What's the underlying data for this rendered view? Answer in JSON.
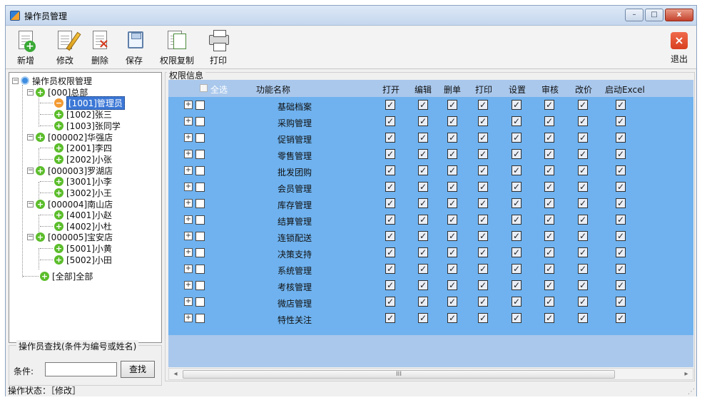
{
  "window": {
    "title": "操作员管理",
    "minimize": "–",
    "maximize": "□",
    "close": "x"
  },
  "toolbar": {
    "new_label": "新增",
    "edit_label": "修改",
    "delete_label": "删除",
    "save_label": "保存",
    "copy_permission_label": "权限复制",
    "print_label": "打印",
    "exit_label": "退出"
  },
  "tree": {
    "root": "操作员权限管理",
    "items": [
      {
        "label": "[000]总部",
        "level": 1,
        "icon": "green-plus-icon",
        "selected": false
      },
      {
        "label": "[1001]管理员",
        "level": 2,
        "icon": "orange-minus-icon",
        "selected": true
      },
      {
        "label": "[1002]张三",
        "level": 2,
        "icon": "green-plus-icon",
        "selected": false
      },
      {
        "label": "[1003]张同学",
        "level": 2,
        "icon": "green-plus-icon",
        "selected": false
      },
      {
        "label": "[000002]华强店",
        "level": 1,
        "icon": "green-plus-icon",
        "selected": false
      },
      {
        "label": "[2001]李四",
        "level": 2,
        "icon": "green-plus-icon",
        "selected": false
      },
      {
        "label": "[2002]小张",
        "level": 2,
        "icon": "green-plus-icon",
        "selected": false
      },
      {
        "label": "[000003]罗湖店",
        "level": 1,
        "icon": "green-plus-icon",
        "selected": false
      },
      {
        "label": "[3001]小李",
        "level": 2,
        "icon": "green-plus-icon",
        "selected": false
      },
      {
        "label": "[3002]小王",
        "level": 2,
        "icon": "green-plus-icon",
        "selected": false
      },
      {
        "label": "[000004]南山店",
        "level": 1,
        "icon": "green-plus-icon",
        "selected": false
      },
      {
        "label": "[4001]小赵",
        "level": 2,
        "icon": "green-plus-icon",
        "selected": false
      },
      {
        "label": "[4002]小杜",
        "level": 2,
        "icon": "green-plus-icon",
        "selected": false
      },
      {
        "label": "[000005]宝安店",
        "level": 1,
        "icon": "green-plus-icon",
        "selected": false
      },
      {
        "label": "[5001]小黄",
        "level": 2,
        "icon": "green-plus-icon",
        "selected": false
      },
      {
        "label": "[5002]小田",
        "level": 2,
        "icon": "green-plus-icon",
        "selected": false
      },
      {
        "label": "[全部]全部",
        "level": 1,
        "icon": "green-plus-icon",
        "selected": false
      }
    ]
  },
  "search": {
    "legend": "操作员查找(条件为编号或姓名)",
    "label": "条件:",
    "value": "",
    "button": "查找"
  },
  "permissions": {
    "group_title": "权限信息",
    "select_all": "全选",
    "columns": [
      "功能名称",
      "打开",
      "编辑",
      "删单",
      "打印",
      "设置",
      "审核",
      "改价",
      "启动Excel"
    ],
    "rows": [
      {
        "name": "基础档案",
        "checks": [
          true,
          true,
          true,
          true,
          true,
          true,
          true,
          true
        ]
      },
      {
        "name": "采购管理",
        "checks": [
          true,
          true,
          true,
          true,
          true,
          true,
          true,
          true
        ]
      },
      {
        "name": "促销管理",
        "checks": [
          true,
          true,
          true,
          true,
          true,
          true,
          true,
          true
        ]
      },
      {
        "name": "零售管理",
        "checks": [
          true,
          true,
          true,
          true,
          true,
          true,
          true,
          true
        ]
      },
      {
        "name": "批发团购",
        "checks": [
          true,
          true,
          true,
          true,
          true,
          true,
          true,
          true
        ]
      },
      {
        "name": "会员管理",
        "checks": [
          true,
          true,
          true,
          true,
          true,
          true,
          true,
          true
        ]
      },
      {
        "name": "库存管理",
        "checks": [
          true,
          true,
          true,
          true,
          true,
          true,
          true,
          true
        ]
      },
      {
        "name": "结算管理",
        "checks": [
          true,
          true,
          true,
          true,
          true,
          true,
          true,
          true
        ]
      },
      {
        "name": "连锁配送",
        "checks": [
          true,
          true,
          true,
          true,
          true,
          true,
          true,
          true
        ]
      },
      {
        "name": "决策支持",
        "checks": [
          true,
          true,
          true,
          true,
          true,
          true,
          true,
          true
        ]
      },
      {
        "name": "系统管理",
        "checks": [
          true,
          true,
          true,
          true,
          true,
          true,
          true,
          true
        ]
      },
      {
        "name": "考核管理",
        "checks": [
          true,
          true,
          true,
          true,
          true,
          true,
          true,
          true
        ]
      },
      {
        "name": "微店管理",
        "checks": [
          true,
          true,
          true,
          true,
          true,
          true,
          true,
          true
        ]
      },
      {
        "name": "特性关注",
        "checks": [
          true,
          true,
          true,
          true,
          true,
          true,
          true,
          true
        ]
      }
    ]
  },
  "scroll": {
    "left": "◂",
    "right": "▸",
    "thumb": "III"
  },
  "status": "操作状态：［修改］",
  "colors": {
    "selected": "#3b77d6",
    "grid_background": "#6fb2ef",
    "grid_header": "#aac8ec"
  }
}
